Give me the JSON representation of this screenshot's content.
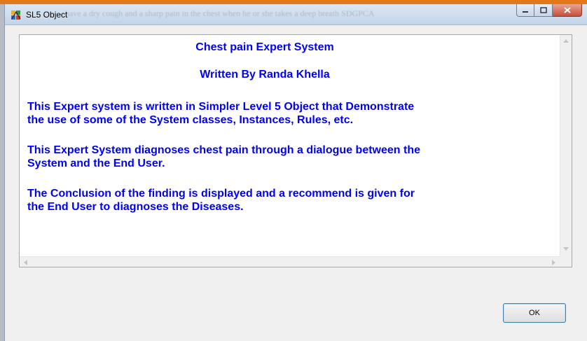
{
  "window": {
    "title": "SL5 Object",
    "background_text": "have a dry cough and a sharp pain in the chest when he or she takes a deep breath SDGPCA"
  },
  "content": {
    "heading_title": "Chest pain Expert System",
    "heading_author": "Written By Randa Khella",
    "paragraphs": [
      {
        "line1": "This Expert system is written in Simpler Level 5 Object that Demonstrate",
        "line2": "the use of some of the System classes, Instances, Rules, etc."
      },
      {
        "line1": "This Expert System diagnoses chest pain through a dialogue between the",
        "line2": "System and the End User."
      },
      {
        "line1": "The Conclusion of the finding is displayed and a recommend is given for",
        "line2": "the End User to  diagnoses the Diseases."
      }
    ]
  },
  "buttons": {
    "ok_label": "OK"
  },
  "colors": {
    "text_blue": "#0000ff",
    "close_red": "#c6503a",
    "accent_orange": "#e2781a"
  }
}
